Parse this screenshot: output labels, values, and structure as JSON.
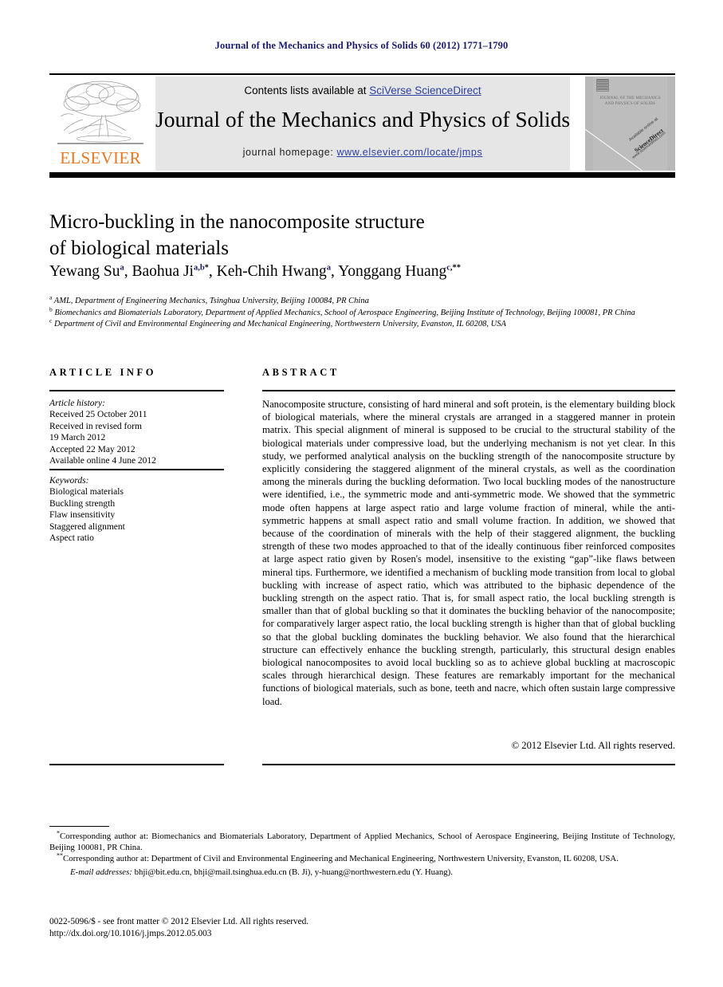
{
  "running_head": "Journal of the Mechanics and Physics of Solids 60 (2012) 1771–1790",
  "masthead": {
    "contents_prefix": "Contents lists available at ",
    "contents_link": "SciVerse ScienceDirect",
    "journal_title": "Journal of the Mechanics and Physics of Solids",
    "homepage_prefix": "journal homepage: ",
    "homepage_url": "www.elsevier.com/locate/jmps",
    "publisher": "ELSEVIER",
    "publisher_color": "#E87722",
    "link_color": "#2b3fa0",
    "band_color": "#e6e6e6",
    "cover": {
      "title_lines": "JOURNAL OF THE MECHANICS AND PHYSICS OF SOLIDS",
      "diag_small": "Available online at",
      "diag_brand": "ScienceDirect",
      "diag_sub": "www.sciencedirect.com"
    }
  },
  "article": {
    "title_line1": "Micro-buckling in the nanocomposite structure",
    "title_line2": "of biological materials",
    "authors": [
      {
        "name": "Yewang Su",
        "sup": "a",
        "sup_black": ""
      },
      {
        "name": "Baohua Ji",
        "sup": "a,b",
        "sup_black": "*"
      },
      {
        "name": "Keh-Chih Hwang",
        "sup": "a",
        "sup_black": ""
      },
      {
        "name": "Yonggang Huang",
        "sup": "c",
        "sup_black": ",**"
      }
    ],
    "affiliations": [
      {
        "marker": "a",
        "text": "AML, Department of Engineering Mechanics, Tsinghua University, Beijing 100084, PR China"
      },
      {
        "marker": "b",
        "text": "Biomechanics and Biomaterials Laboratory, Department of Applied Mechanics, School of Aerospace Engineering, Beijing Institute of Technology, Beijing 100081, PR China"
      },
      {
        "marker": "c",
        "text": "Department of Civil and Environmental Engineering and Mechanical Engineering, Northwestern University, Evanston, IL 60208, USA"
      }
    ]
  },
  "info": {
    "header": "ARTICLE INFO",
    "history_label": "Article history:",
    "history": [
      "Received 25 October 2011",
      "Received in revised form",
      "19 March 2012",
      "Accepted 22 May 2012",
      "Available online 4 June 2012"
    ],
    "keywords_label": "Keywords:",
    "keywords": [
      "Biological materials",
      "Buckling strength",
      "Flaw insensitivity",
      "Staggered alignment",
      "Aspect ratio"
    ]
  },
  "abstract": {
    "header": "ABSTRACT",
    "text": "Nanocomposite structure, consisting of hard mineral and soft protein, is the elementary building block of biological materials, where the mineral crystals are arranged in a staggered manner in protein matrix. This special alignment of mineral is supposed to be crucial to the structural stability of the biological materials under compressive load, but the underlying mechanism is not yet clear. In this study, we performed analytical analysis on the buckling strength of the nanocomposite structure by explicitly considering the staggered alignment of the mineral crystals, as well as the coordination among the minerals during the buckling deformation. Two local buckling modes of the nanostructure were identified, i.e., the symmetric mode and anti-symmetric mode. We showed that the symmetric mode often happens at large aspect ratio and large volume fraction of mineral, while the anti-symmetric happens at small aspect ratio and small volume fraction. In addition, we showed that because of the coordination of minerals with the help of their staggered alignment, the buckling strength of these two modes approached to that of the ideally continuous fiber reinforced composites at large aspect ratio given by Rosen's model, insensitive to the existing “gap”-like flaws between mineral tips. Furthermore, we identified a mechanism of buckling mode transition from local to global buckling with increase of aspect ratio, which was attributed to the biphasic dependence of the buckling strength on the aspect ratio. That is, for small aspect ratio, the local buckling strength is smaller than that of global buckling so that it dominates the buckling behavior of the nanocomposite; for comparatively larger aspect ratio, the local buckling strength is higher than that of global buckling so that the global buckling dominates the buckling behavior. We also found that the hierarchical structure can effectively enhance the buckling strength, particularly, this structural design enables biological nanocomposites to avoid local buckling so as to achieve global buckling at macroscopic scales through hierarchical design. These features are remarkably important for the mechanical functions of biological materials, such as bone, teeth and nacre, which often sustain large compressive load.",
    "copyright": "© 2012 Elsevier Ltd. All rights reserved."
  },
  "footnotes": {
    "note1_marker": "*",
    "note1": "Corresponding author at: Biomechanics and Biomaterials Laboratory, Department of Applied Mechanics, School of Aerospace Engineering, Beijing Institute of Technology, Beijing 100081, PR China.",
    "note2_marker": "**",
    "note2": "Corresponding author at: Department of Civil and Environmental Engineering and Mechanical Engineering, Northwestern University, Evanston, IL 60208, USA.",
    "email_label": "E-mail addresses:",
    "emails": "bhji@bit.edu.cn, bhji@mail.tsinghua.edu.cn (B. Ji), y-huang@northwestern.edu (Y. Huang)."
  },
  "imprint": {
    "line1": "0022-5096/$ - see front matter © 2012 Elsevier Ltd. All rights reserved.",
    "line2": "http://dx.doi.org/10.1016/j.jmps.2012.05.003"
  }
}
